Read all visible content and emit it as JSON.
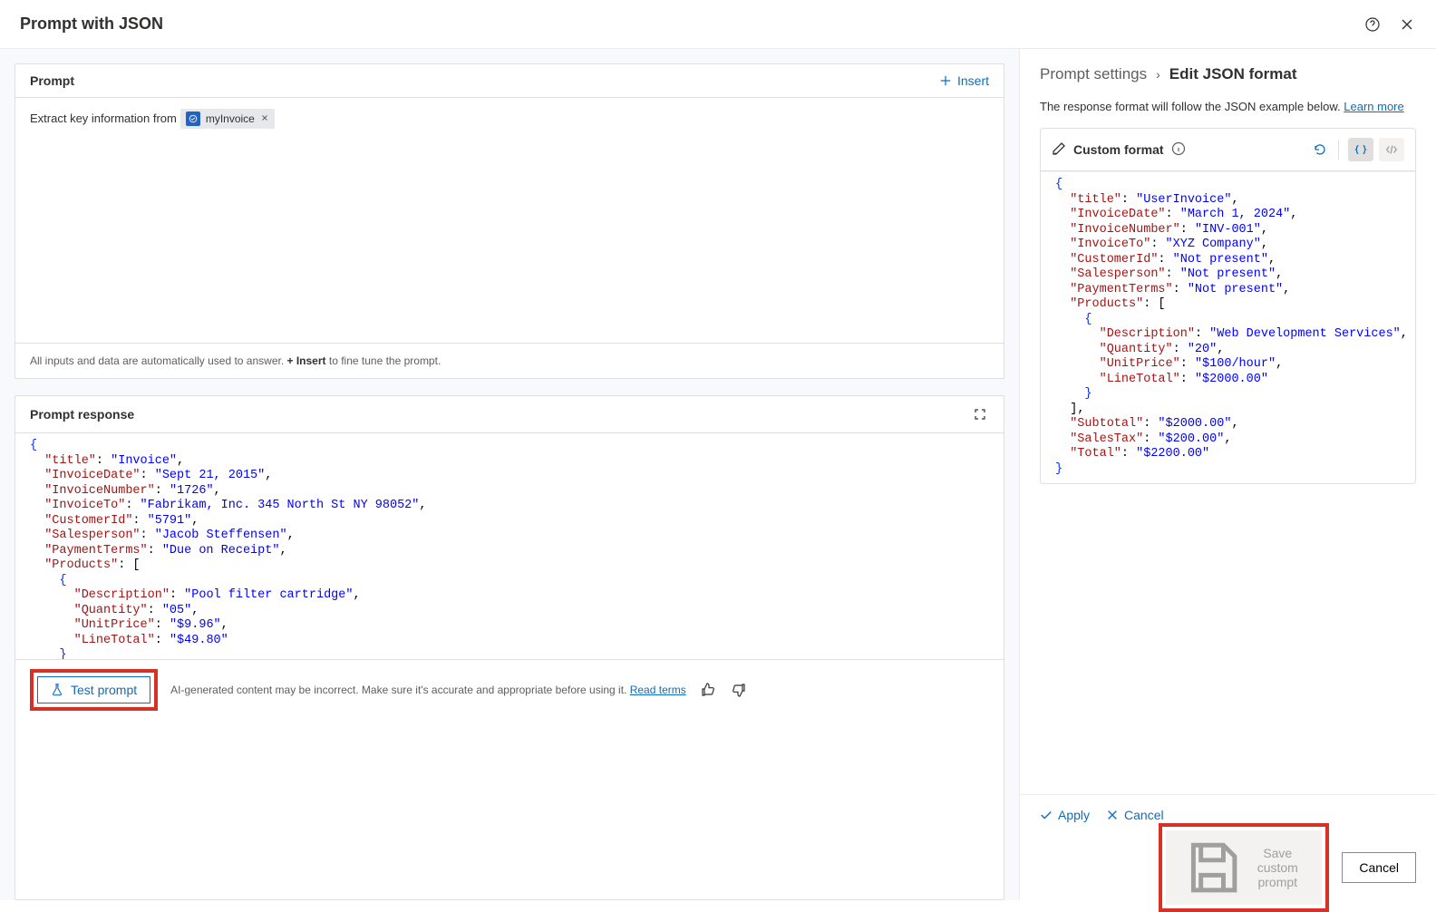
{
  "header": {
    "title": "Prompt with JSON"
  },
  "prompt": {
    "section_title": "Prompt",
    "insert_label": "Insert",
    "text_before": "Extract key information from",
    "chip": {
      "label": "myInvoice"
    },
    "hint_before": "All inputs and data are automatically used to answer. ",
    "hint_insert": "+ Insert",
    "hint_after": " to fine tune the prompt."
  },
  "response": {
    "section_title": "Prompt response"
  },
  "response_footer": {
    "test_label": "Test prompt",
    "disclaimer": "AI-generated content may be incorrect. Make sure it's accurate and appropriate before using it. ",
    "read_terms": "Read terms"
  },
  "settings": {
    "crumb1": "Prompt settings",
    "crumb2": "Edit JSON format",
    "intro_text": "The response format will follow the JSON example below. ",
    "learn_more": "Learn more",
    "custom_format_label": "Custom format"
  },
  "settings_actions": {
    "apply": "Apply",
    "cancel": "Cancel"
  },
  "footer": {
    "save": "Save custom prompt",
    "cancel": "Cancel"
  },
  "chart_data": {
    "response_json": {
      "title": "Invoice",
      "InvoiceDate": "Sept 21, 2015",
      "InvoiceNumber": "1726",
      "InvoiceTo": "Fabrikam, Inc. 345 North St NY 98052",
      "CustomerId": "5791",
      "Salesperson": "Jacob Steffensen",
      "PaymentTerms": "Due on Receipt",
      "Products": [
        {
          "Description": "Pool filter cartridge",
          "Quantity": "05",
          "UnitPrice": "$9.96",
          "LineTotal": "$49.80"
        }
      ]
    },
    "custom_format_json": {
      "title": "UserInvoice",
      "InvoiceDate": "March 1, 2024",
      "InvoiceNumber": "INV-001",
      "InvoiceTo": "XYZ Company",
      "CustomerId": "Not present",
      "Salesperson": "Not present",
      "PaymentTerms": "Not present",
      "Products": [
        {
          "Description": "Web Development Services",
          "Quantity": "20",
          "UnitPrice": "$100/hour",
          "LineTotal": "$2000.00"
        }
      ],
      "Subtotal": "$2000.00",
      "SalesTax": "$200.00",
      "Total": "$2200.00"
    }
  }
}
